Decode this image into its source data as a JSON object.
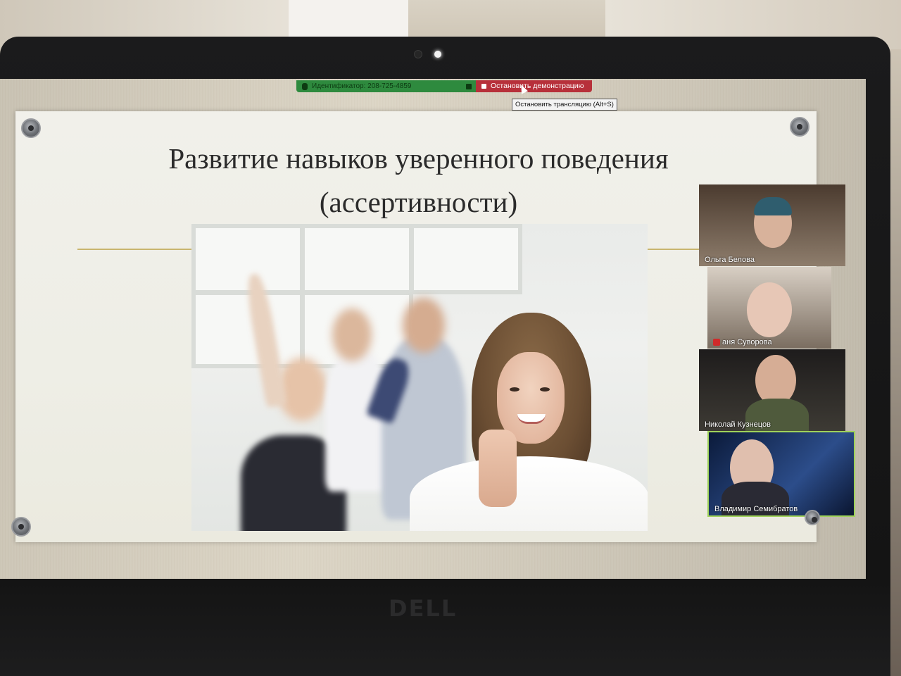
{
  "share_bar": {
    "meeting_id_label": "Идентификатор: 208-725-4859",
    "stop_button": "Остановить демонстрацию",
    "tooltip": "Остановить трансляцию (Alt+S)"
  },
  "slide": {
    "title_line1": "Развитие навыков уверенного поведения",
    "title_line2": "(ассертивности)"
  },
  "participants": [
    {
      "name": "Ольга Белова",
      "muted": false,
      "active": false
    },
    {
      "name": "аня Суворова",
      "muted": true,
      "active": false
    },
    {
      "name": "Николай Кузнецов",
      "muted": false,
      "active": false
    },
    {
      "name": "Владимир Семибратов",
      "muted": false,
      "active": true
    }
  ],
  "laptop": {
    "brand": "DELL"
  },
  "colors": {
    "share_green": "#2e8a3e",
    "stop_red": "#b7303a",
    "active_border": "#9fd25a"
  }
}
